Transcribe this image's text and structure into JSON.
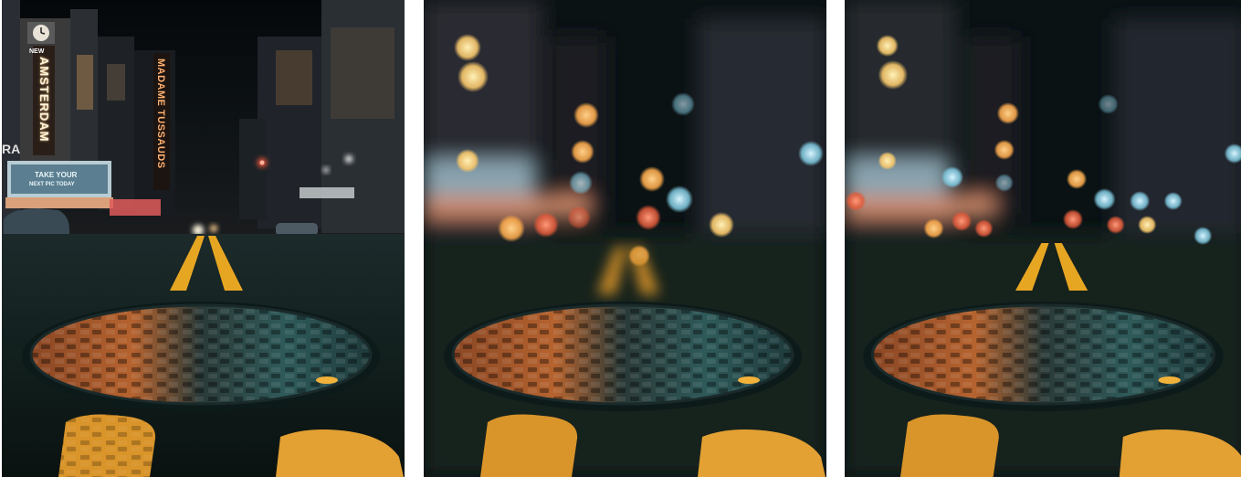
{
  "images": [
    {
      "variant": "sharp",
      "signs": {
        "new": "NEW",
        "amsterdam": "AMSTERDAM",
        "madame_tussauds": "MADAME TUSSAUDS",
        "billboard_line1": "TAKE YOUR",
        "billboard_line2": "NEXT PIC TODAY",
        "ra": "RA"
      }
    },
    {
      "variant": "blurred"
    },
    {
      "variant": "bokeh"
    }
  ],
  "colors": {
    "sky": "#06090c",
    "road": "#13211f",
    "lane_yellow": "#e7a622",
    "neon_orange": "#ffb55a",
    "cover_orange": "#b05a2e",
    "cover_teal": "#2c5556"
  }
}
